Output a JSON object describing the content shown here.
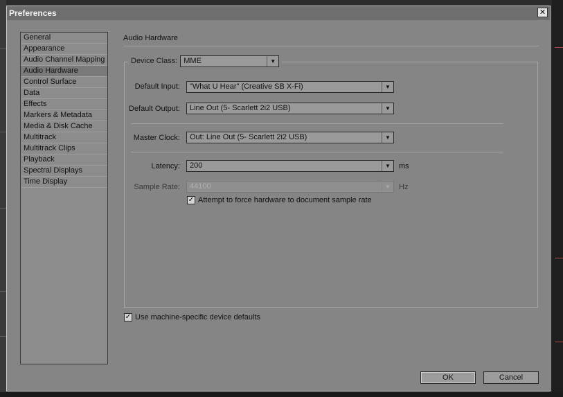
{
  "window": {
    "title": "Preferences",
    "close_glyph": "✕"
  },
  "sidebar": {
    "items": [
      {
        "label": "General"
      },
      {
        "label": "Appearance"
      },
      {
        "label": "Audio Channel Mapping"
      },
      {
        "label": "Audio Hardware",
        "selected": true
      },
      {
        "label": "Control Surface"
      },
      {
        "label": "Data"
      },
      {
        "label": "Effects"
      },
      {
        "label": "Markers & Metadata"
      },
      {
        "label": "Media & Disk Cache"
      },
      {
        "label": "Multitrack"
      },
      {
        "label": "Multitrack Clips"
      },
      {
        "label": "Playback"
      },
      {
        "label": "Spectral Displays"
      },
      {
        "label": "Time Display"
      }
    ]
  },
  "panel": {
    "title": "Audio Hardware",
    "device_class": {
      "label": "Device Class:",
      "value": "MME"
    },
    "default_input": {
      "label": "Default Input:",
      "value": "\"What U Hear\" (Creative SB X-Fi)"
    },
    "default_output": {
      "label": "Default Output:",
      "value": "Line Out (5- Scarlett 2i2 USB)"
    },
    "master_clock": {
      "label": "Master Clock:",
      "value": "Out: Line Out (5- Scarlett 2i2 USB)"
    },
    "latency": {
      "label": "Latency:",
      "value": "200",
      "unit": "ms"
    },
    "sample_rate": {
      "label": "Sample Rate:",
      "value": "44100",
      "unit": "Hz",
      "disabled": true
    },
    "force_sample_rate": {
      "label": "Attempt to force hardware to document sample rate",
      "checked": true
    },
    "machine_defaults": {
      "label": "Use machine-specific device defaults",
      "checked": true
    }
  },
  "buttons": {
    "ok": "OK",
    "cancel": "Cancel"
  },
  "glyphs": {
    "dropdown_arrow": "▼",
    "check": "✓"
  }
}
